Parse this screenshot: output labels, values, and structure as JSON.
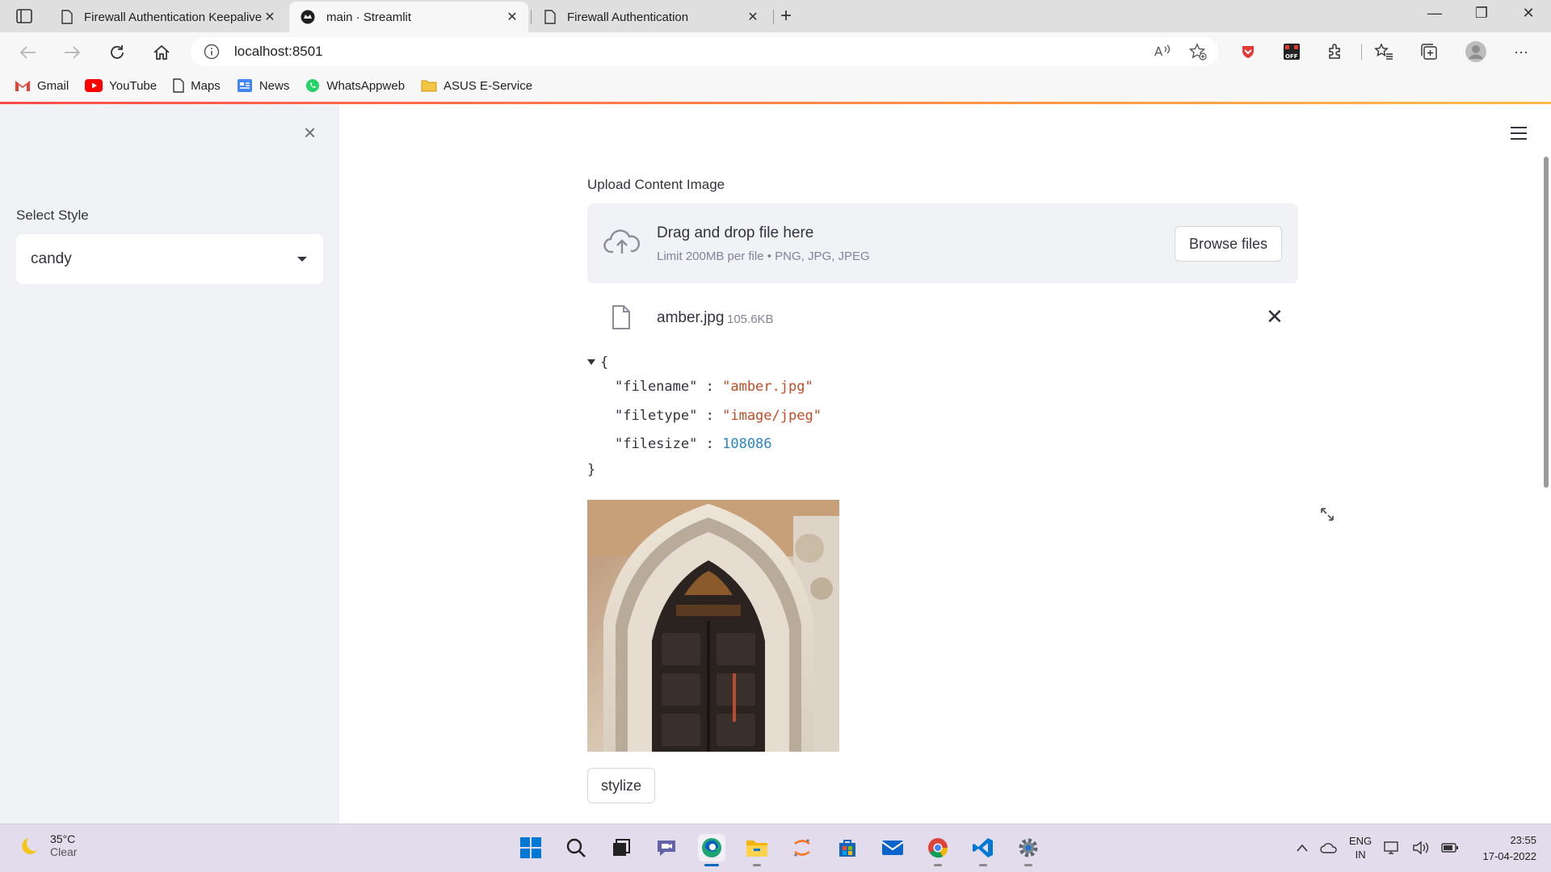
{
  "browser": {
    "tabs": [
      {
        "title": "Firewall Authentication Keepalive",
        "close": "✕"
      },
      {
        "title": "main · Streamlit",
        "close": "✕"
      },
      {
        "title": "Firewall Authentication",
        "close": "✕"
      }
    ],
    "new_tab": "+",
    "window_controls": {
      "minimize": "—",
      "restore": "❐",
      "close": "✕"
    },
    "url": "localhost:8501",
    "bookmarks": [
      {
        "label": "Gmail",
        "icon": "gmail-icon"
      },
      {
        "label": "YouTube",
        "icon": "youtube-icon"
      },
      {
        "label": "Maps",
        "icon": "page-icon"
      },
      {
        "label": "News",
        "icon": "news-icon"
      },
      {
        "label": "WhatsAppweb",
        "icon": "whatsapp-icon"
      },
      {
        "label": "ASUS E-Service",
        "icon": "folder-icon"
      }
    ],
    "more": "···"
  },
  "sidebar": {
    "close": "×",
    "select_label": "Select Style",
    "select_value": "candy"
  },
  "main": {
    "uploader": {
      "label": "Upload Content Image",
      "title": "Drag and drop file here",
      "subtitle": "Limit 200MB per file • PNG, JPG, JPEG",
      "browse": "Browse files"
    },
    "file": {
      "name": "amber.jpg",
      "size": "105.6KB",
      "remove": "✕"
    },
    "json": {
      "open": "{",
      "close": "}",
      "rows": [
        {
          "key": "\"filename\"",
          "sep": ":",
          "value": "\"amber.jpg\""
        },
        {
          "key": "\"filetype\"",
          "sep": ":",
          "value": "\"image/jpeg\""
        },
        {
          "key": "\"filesize\"",
          "sep": ":",
          "value": "108086"
        }
      ]
    },
    "button": "stylize"
  },
  "taskbar": {
    "temp": "35°C",
    "condition": "Clear",
    "lang_top": "ENG",
    "lang_bottom": "IN",
    "time": "23:55",
    "date": "17-04-2022"
  },
  "colors": {
    "accent": "#ff4b4b",
    "json_string": "#c44c26",
    "json_number": "#2a86c4",
    "sidebar_bg": "#f0f2f6"
  }
}
